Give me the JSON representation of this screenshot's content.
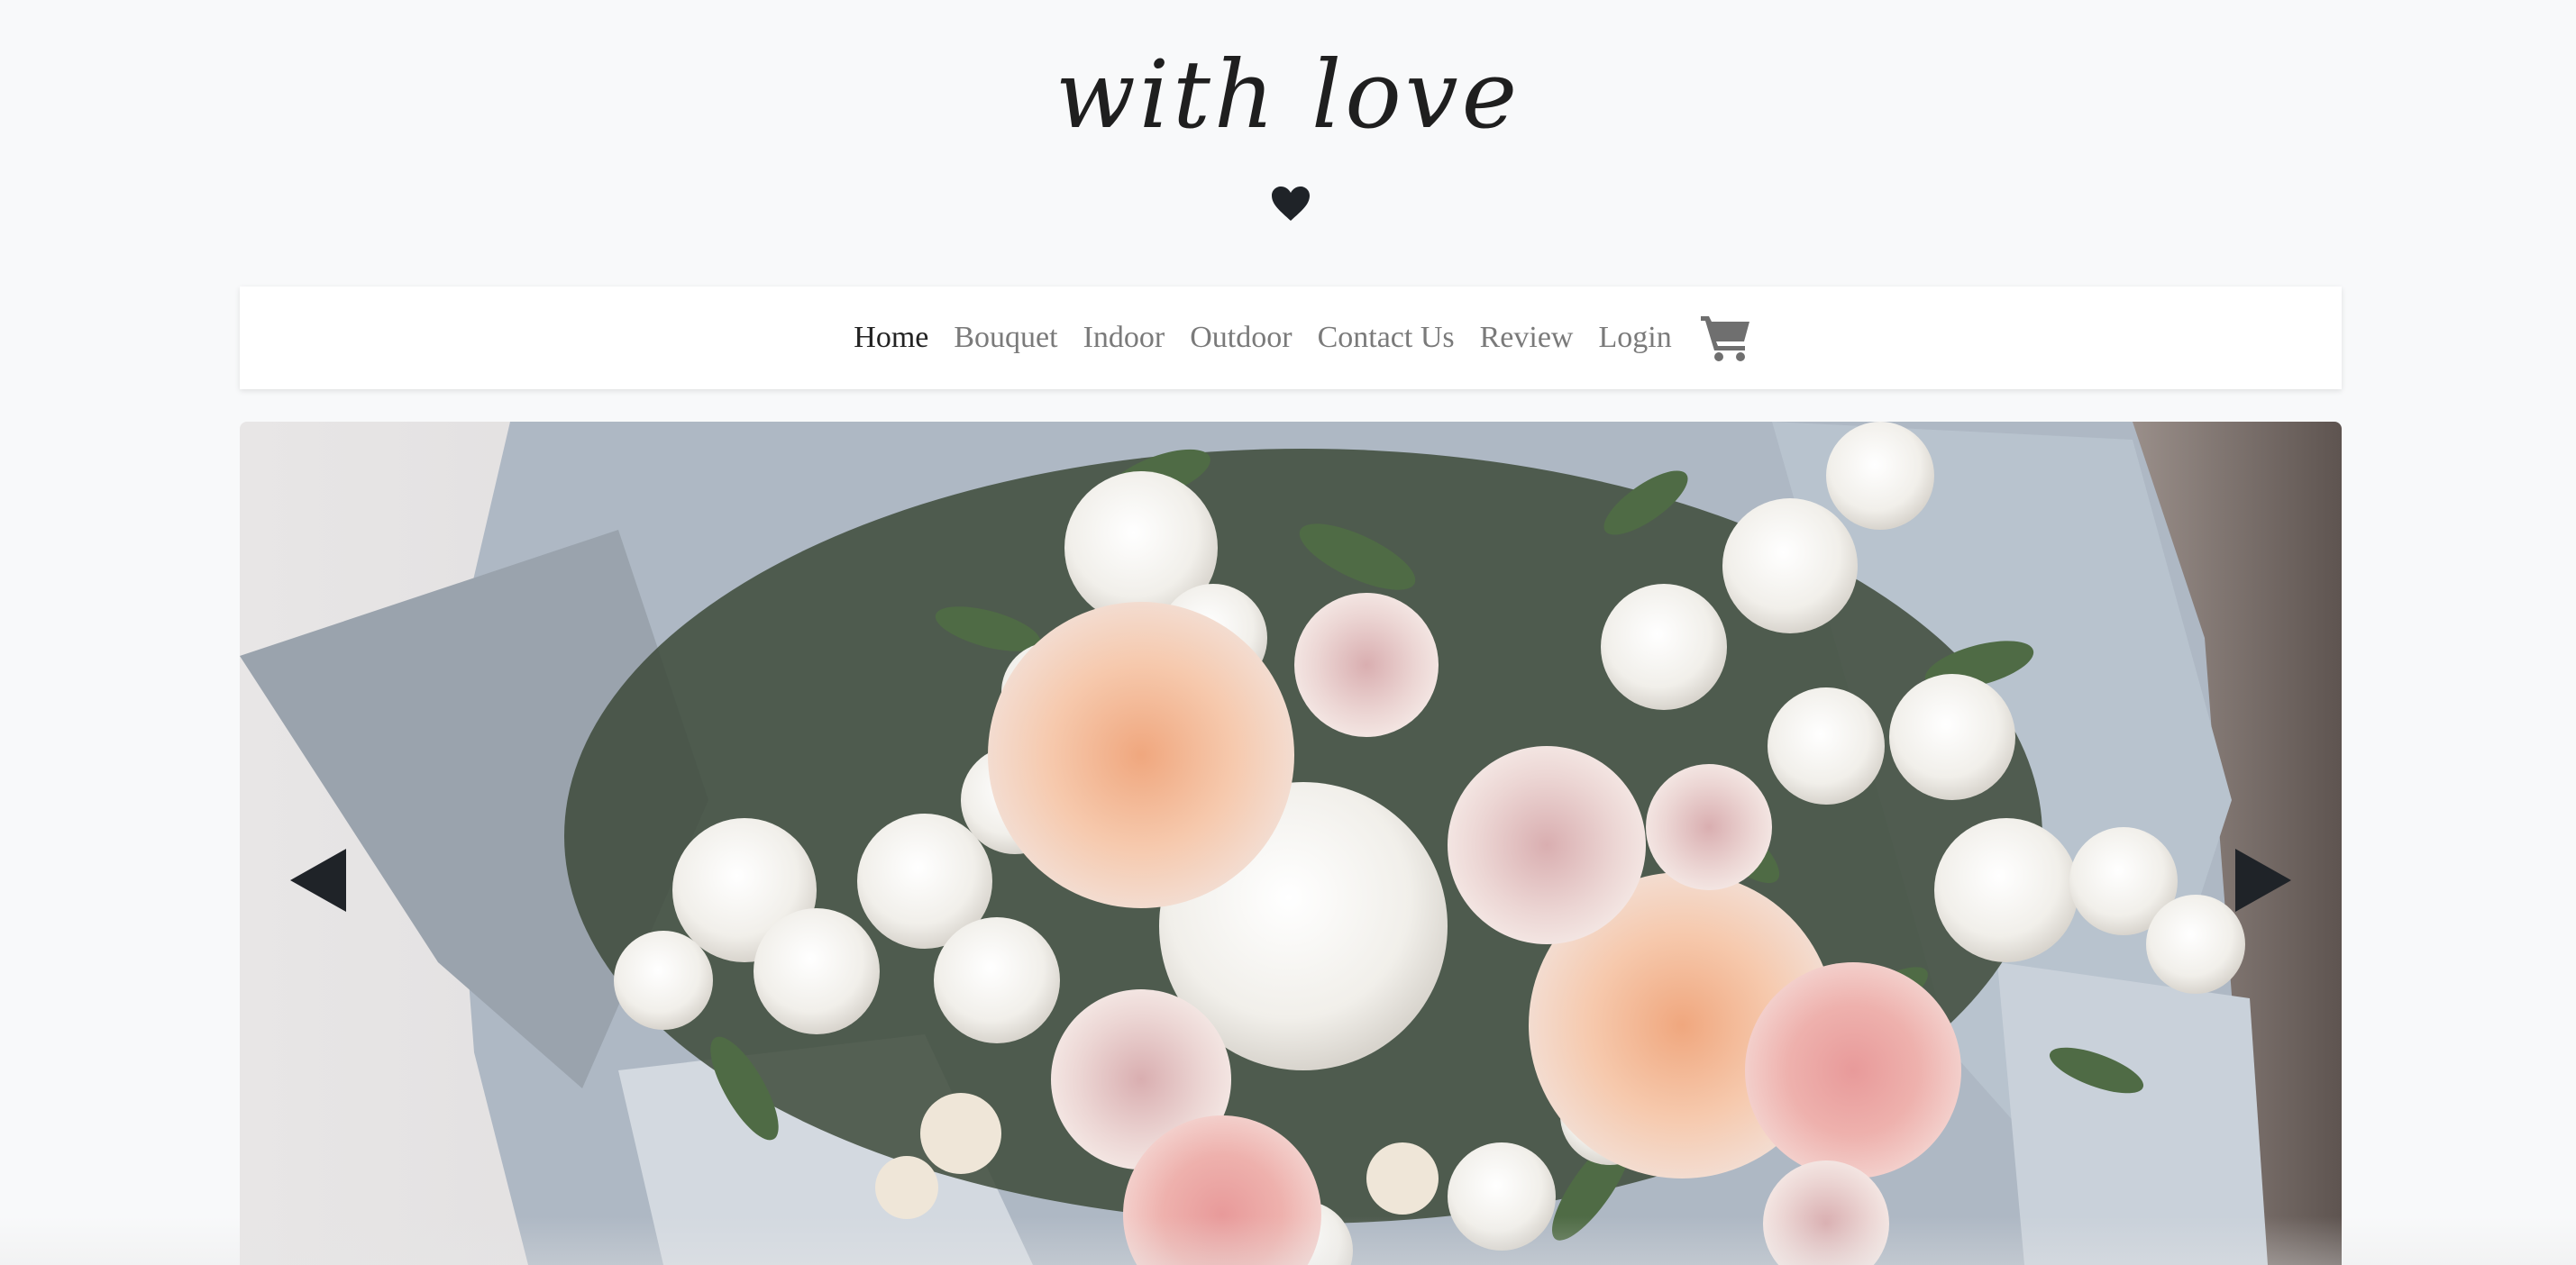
{
  "header": {
    "brand": "with love",
    "heart_icon": "heart-icon"
  },
  "nav": {
    "items": [
      {
        "label": "Home",
        "active": true
      },
      {
        "label": "Bouquet",
        "active": false
      },
      {
        "label": "Indoor",
        "active": false
      },
      {
        "label": "Outdoor",
        "active": false
      },
      {
        "label": "Contact Us",
        "active": false
      },
      {
        "label": "Review",
        "active": false
      },
      {
        "label": "Login",
        "active": false
      }
    ],
    "cart_icon": "shopping-cart-icon"
  },
  "carousel": {
    "prev_icon": "triangle-left-icon",
    "next_icon": "triangle-right-icon",
    "image_subject": "bouquet of peach roses, white stock flowers, carnations and eucalyptus wrapped in grey-blue paper"
  },
  "colors": {
    "page_background": "#f8f9fa",
    "navbar_background": "#ffffff",
    "nav_link": "#7a7a7a",
    "nav_link_active": "#222222",
    "brand_text": "#1f1f1f",
    "icon_dark": "#1f2328"
  }
}
